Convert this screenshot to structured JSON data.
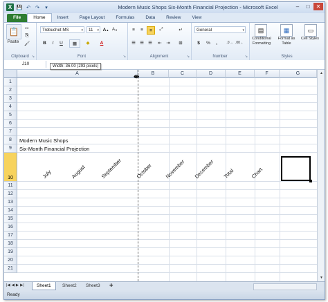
{
  "app": {
    "title": "Modern Music Shops Six-Month Financial Projection - Microsoft Excel",
    "accent_color": "#2e7d32",
    "window_buttons": [
      "–",
      "□",
      "✕"
    ]
  },
  "quick_access": {
    "save_icon": "💾",
    "undo_icon": "↶",
    "redo_icon": "↷",
    "customize_icon": "▾"
  },
  "tabs": [
    "File",
    "Home",
    "Insert",
    "Page Layout",
    "Formulas",
    "Data",
    "Review",
    "View"
  ],
  "ribbon": {
    "clipboard": {
      "paste": "Paste",
      "cut_icon": "✂",
      "copy_icon": "⎘",
      "format_painter_icon": "🖌",
      "label": "Clipboard"
    },
    "font": {
      "name": "Trebuchet MS",
      "size": "11",
      "bold": "B",
      "italic": "I",
      "underline": "U",
      "grow": "A",
      "shrink": "A",
      "fill_icon": "◆",
      "color_letter": "A",
      "label": "Font"
    },
    "alignment": {
      "label": "Alignment"
    },
    "number": {
      "format": "General",
      "currency": "$",
      "percent": "%",
      "comma": ",",
      "label": "Number"
    },
    "styles": {
      "conditional": "Conditional Formatting",
      "format_table": "Format as Table",
      "cell_styles": "Cell Styles",
      "label": "Styles"
    }
  },
  "formula_bar": {
    "name_box": "J10",
    "tooltip": "Width: 36.00 (293 pixels)"
  },
  "columns": [
    "A",
    "B",
    "C",
    "D",
    "E",
    "F",
    "G"
  ],
  "rows": [
    "1",
    "2",
    "3",
    "4",
    "5",
    "6",
    "7",
    "8",
    "9",
    "10",
    "11",
    "12",
    "13",
    "14",
    "15",
    "16",
    "17",
    "18",
    "19",
    "20",
    "21"
  ],
  "cells": {
    "a8": "Modern Music Shops",
    "a9": "Six-Month Financial Projection",
    "headers": [
      "July",
      "August",
      "September",
      "October",
      "November",
      "December",
      "Total",
      "Chart"
    ]
  },
  "sheets": [
    "Sheet1",
    "Sheet2",
    "Sheet3"
  ],
  "status": "Ready"
}
